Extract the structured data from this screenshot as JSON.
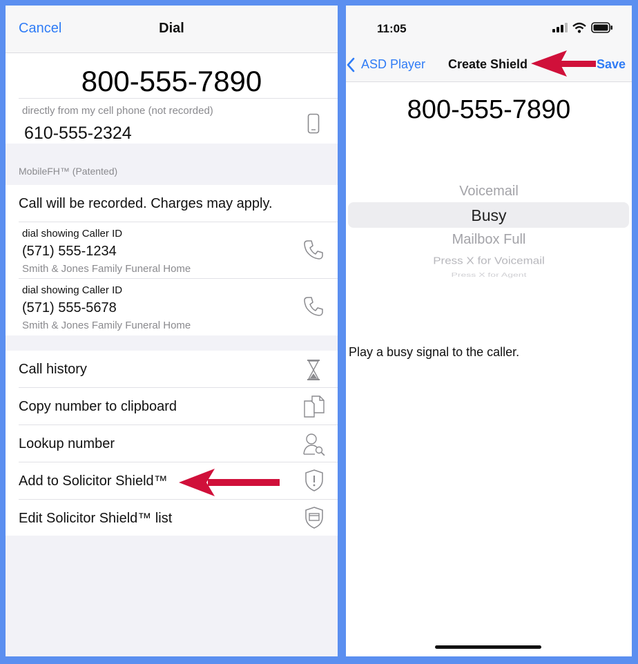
{
  "dial_screen": {
    "nav": {
      "cancel_label": "Cancel",
      "title": "Dial"
    },
    "dialed_number": "800-555-7890",
    "cell_hint": "directly from my cell phone (not recorded)",
    "cell_number": "610-555-2324",
    "section_label": "MobileFH™ (Patented)",
    "recording_notice": "Call will be recorded. Charges may apply.",
    "caller_ids": [
      {
        "caption": "dial showing Caller ID",
        "number": "(571) 555-1234",
        "name": "Smith & Jones Family Funeral Home"
      },
      {
        "caption": "dial showing Caller ID",
        "number": "(571) 555-5678",
        "name": "Smith & Jones Family Funeral Home"
      }
    ],
    "actions": [
      {
        "label": "Call history",
        "icon": "hourglass-icon"
      },
      {
        "label": "Copy number to clipboard",
        "icon": "copy-icon"
      },
      {
        "label": "Lookup number",
        "icon": "person-search-icon"
      },
      {
        "label": "Add to Solicitor Shield™",
        "icon": "shield-exclamation-icon"
      },
      {
        "label": "Edit Solicitor Shield™ list",
        "icon": "shield-list-icon"
      }
    ],
    "accent_color": "#2f7cf6",
    "arrow_color": "#d0103a"
  },
  "shield_screen": {
    "status": {
      "time": "11:05"
    },
    "nav": {
      "back_label": "ASD Player",
      "title": "Create Shield",
      "save_label": "Save"
    },
    "number": "800-555-7890",
    "picker": {
      "options": [
        "Voicemail",
        "Busy",
        "Mailbox Full",
        "Press X for Voicemail",
        "Press X for Agent"
      ],
      "selected": "Busy"
    },
    "description": "Play a busy signal to the caller."
  }
}
